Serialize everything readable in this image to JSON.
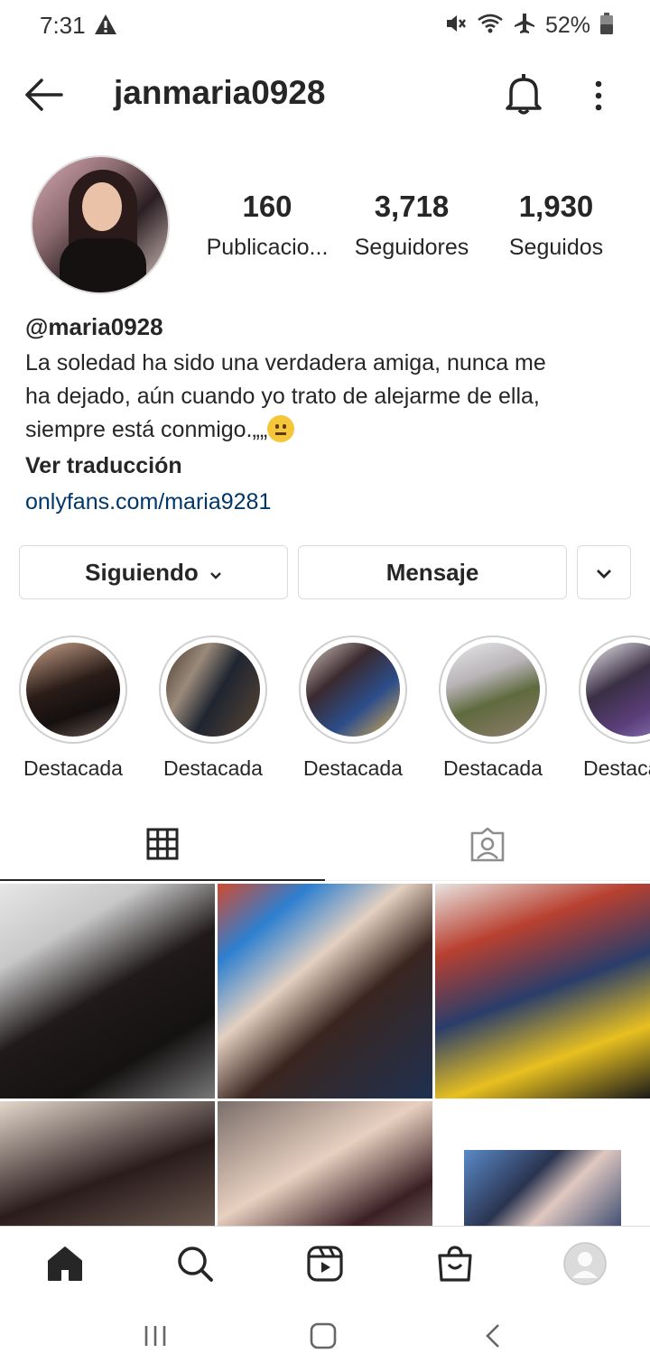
{
  "status_bar": {
    "time": "7:31",
    "battery": "52%",
    "icons": [
      "warning-icon",
      "mute-icon",
      "wifi-icon",
      "airplane-icon",
      "battery-icon"
    ]
  },
  "header": {
    "username": "janmaria0928",
    "icons": [
      "back-arrow-icon",
      "bell-icon",
      "more-vertical-icon"
    ]
  },
  "profile": {
    "stats": [
      {
        "value": "160",
        "label": "Publicacio..."
      },
      {
        "value": "3,718",
        "label": "Seguidores"
      },
      {
        "value": "1,930",
        "label": "Seguidos"
      }
    ],
    "name": "@maria0928",
    "bio_line1": "La soledad ha sido una verdadera amiga, nunca me",
    "bio_line2": "ha dejado, aún cuando yo trato de alejarme de ella,",
    "bio_line3": "siempre está conmigo.„„",
    "translate": "Ver traducción",
    "link": "onlyfans.com/maria9281"
  },
  "actions": {
    "following": "Siguiendo",
    "message": "Mensaje"
  },
  "highlights": [
    {
      "label": "Destacada"
    },
    {
      "label": "Destacada"
    },
    {
      "label": "Destacada"
    },
    {
      "label": "Destacada"
    },
    {
      "label": "Destacada"
    }
  ],
  "tabs": [
    "grid-icon",
    "tagged-icon"
  ],
  "bottom_nav": [
    "home-icon",
    "search-icon",
    "reels-icon",
    "shop-icon",
    "profile-avatar-icon"
  ],
  "colors": {
    "text": "#262626",
    "link": "#00376b",
    "border": "#dbdbdb"
  }
}
